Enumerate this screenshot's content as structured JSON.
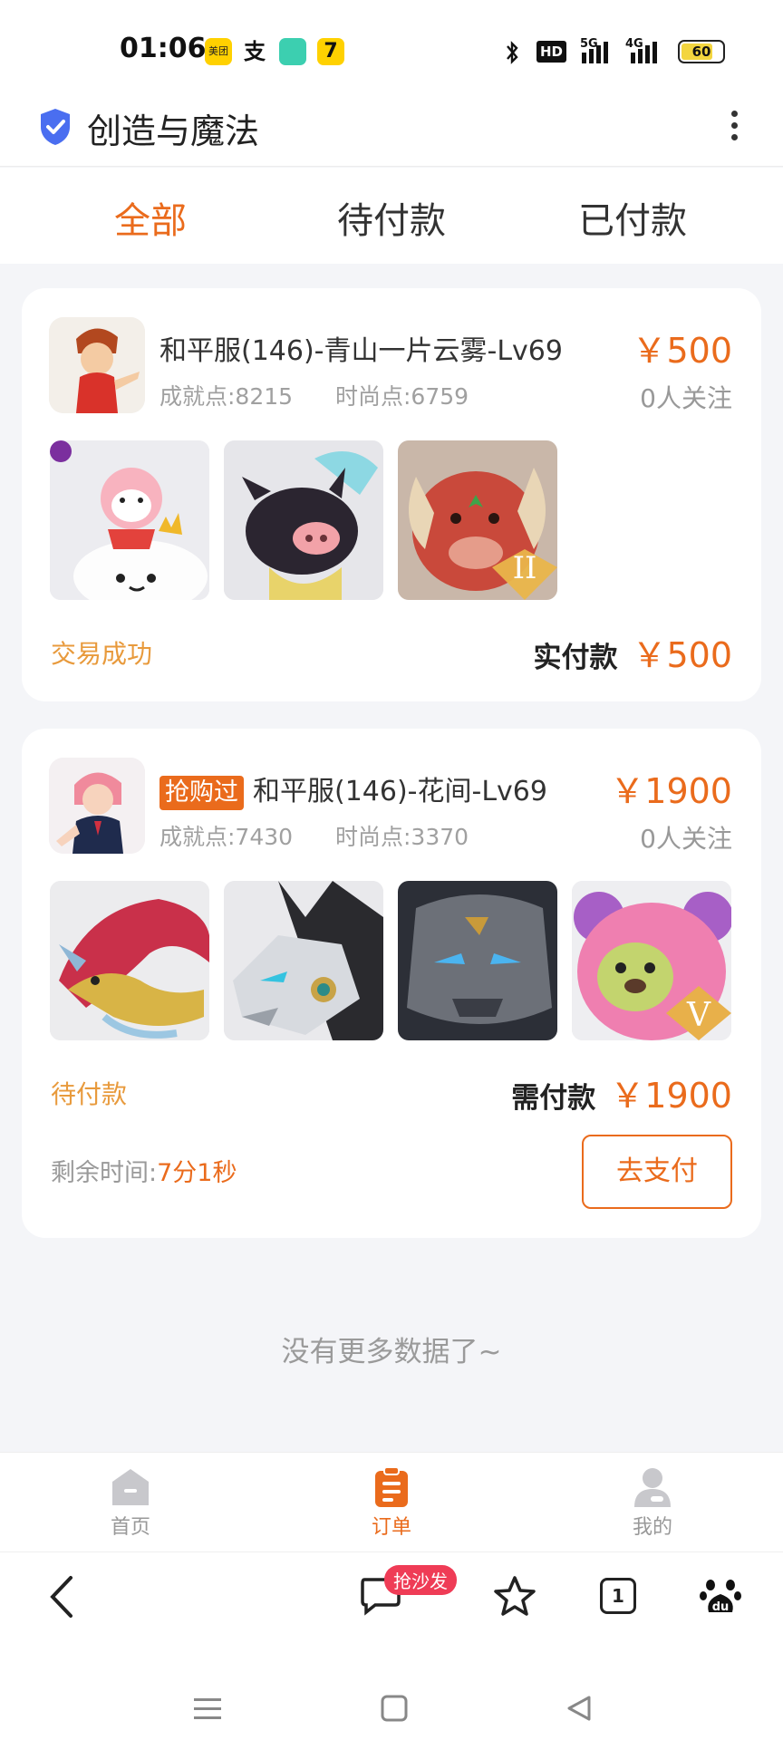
{
  "status_bar": {
    "time": "01:06",
    "apps": [
      "美团",
      "支",
      "",
      "7"
    ],
    "network": [
      "HD",
      "5G",
      "4G"
    ],
    "battery": "60"
  },
  "header": {
    "title": "创造与魔法",
    "icon": "shield-check-icon",
    "menu_icon": "more-vertical-icon"
  },
  "tabs": [
    {
      "label": "全部",
      "active": true
    },
    {
      "label": "待付款",
      "active": false
    },
    {
      "label": "已付款",
      "active": false
    }
  ],
  "orders": [
    {
      "tag": "",
      "title": "和平服(146)-青山一片云雾-Lv69",
      "achievement": "成就点:8215",
      "fashion": "时尚点:6759",
      "price": "￥500",
      "followers": "0人关注",
      "items": [
        "pink-fox-pet",
        "black-pig-mount",
        "red-horned-beast-II"
      ],
      "status": "交易成功",
      "pay_label": "实付款",
      "pay_amount": "￥500"
    },
    {
      "tag": "抢购过",
      "title": "和平服(146)-花间-Lv69",
      "achievement": "成就点:7430",
      "fashion": "时尚点:3370",
      "price": "￥1900",
      "followers": "0人关注",
      "items": [
        "red-dragon",
        "mecha-wolf",
        "stone-golem",
        "pink-bear-V"
      ],
      "status": "待付款",
      "pay_label": "需付款",
      "pay_amount": "￥1900",
      "remaining_label": "剩余时间:",
      "remaining_time": "7分1秒",
      "pay_button": "去支付"
    }
  ],
  "footer_note": "没有更多数据了~",
  "bottom_nav": [
    {
      "label": "首页",
      "icon": "home-icon",
      "active": false
    },
    {
      "label": "订单",
      "icon": "order-clipboard-icon",
      "active": true
    },
    {
      "label": "我的",
      "icon": "user-icon",
      "active": false
    }
  ],
  "browser_bar": {
    "sofa_badge": "抢沙发",
    "tab_count": "1",
    "baidu": "du"
  },
  "colors": {
    "accent": "#ea6b1c",
    "status_success": "#e89a3c",
    "badge_red": "#ef3c56"
  }
}
